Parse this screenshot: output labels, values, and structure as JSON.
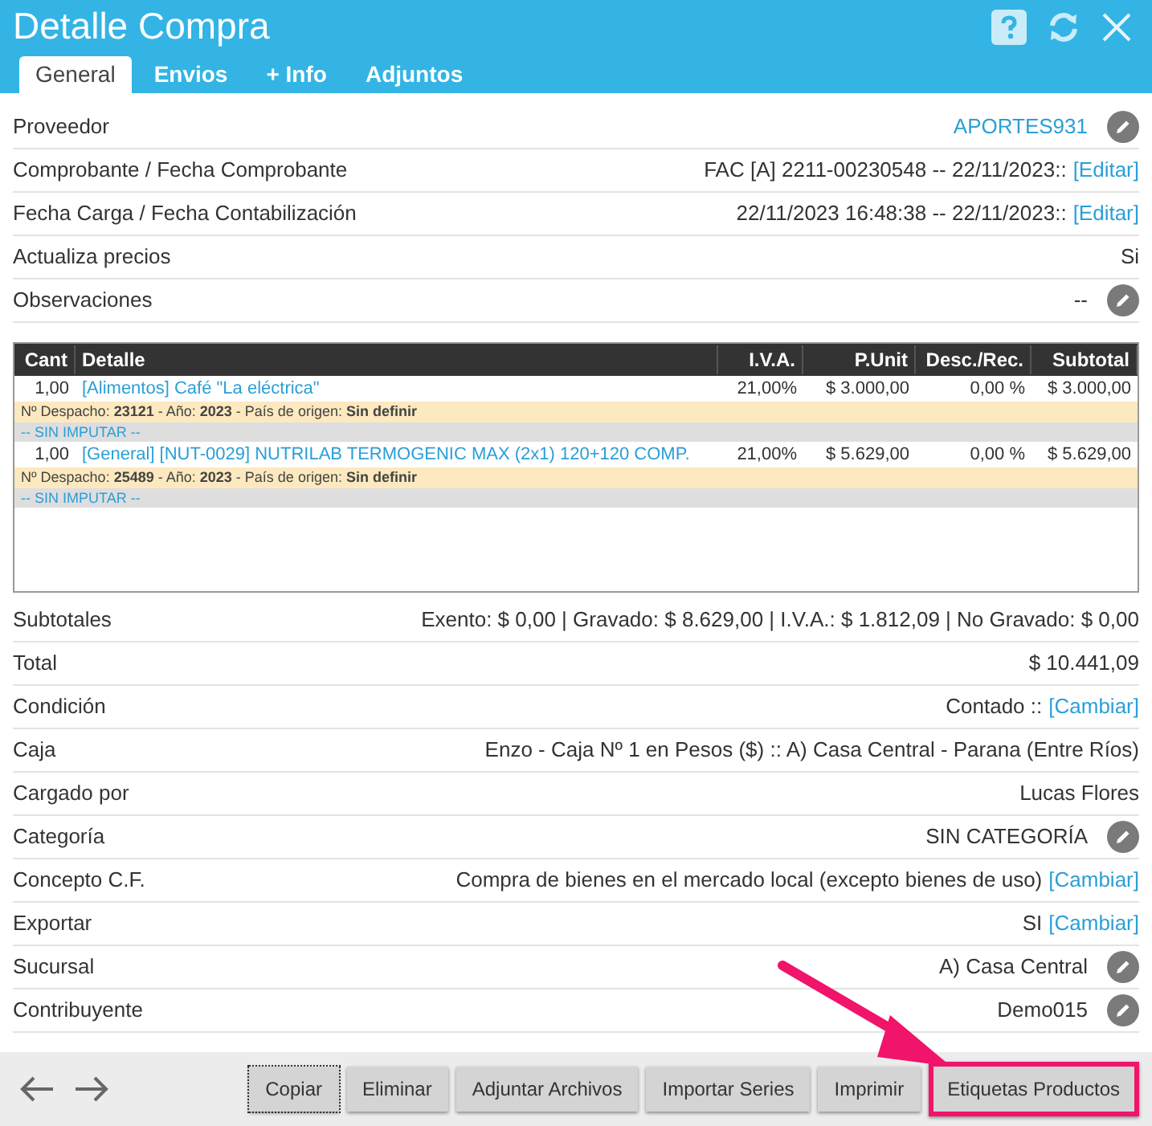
{
  "window": {
    "title": "Detalle Compra"
  },
  "tabs": [
    {
      "label": "General",
      "selected": true
    },
    {
      "label": "Envios",
      "selected": false
    },
    {
      "label": "+ Info",
      "selected": false
    },
    {
      "label": "Adjuntos",
      "selected": false
    }
  ],
  "info_rows": [
    {
      "label": "Proveedor",
      "value": "APORTES931",
      "kind": "link",
      "editable": true
    },
    {
      "label": "Comprobante / Fecha Comprobante",
      "value": "FAC [A] 2211-00230548 -- 22/11/2023::",
      "link": "[Editar]",
      "kind": "plain",
      "editable": false
    },
    {
      "label": "Fecha Carga / Fecha Contabilización",
      "value": "22/11/2023 16:48:38 -- 22/11/2023::",
      "link": "[Editar]",
      "kind": "plain",
      "editable": false
    },
    {
      "label": "Actualiza precios",
      "value": "Si",
      "kind": "plain",
      "editable": false
    },
    {
      "label": "Observaciones",
      "value": "--",
      "kind": "plain",
      "editable": true
    }
  ],
  "table": {
    "columns": [
      "Cant",
      "Detalle",
      "I.V.A.",
      "P.Unit",
      "Desc./Rec.",
      "Subtotal"
    ],
    "rows": [
      {
        "cant": "1,00",
        "detalle": "[Alimentos] Café \"La eléctrica\"",
        "iva": "21,00%",
        "punit": "$ 3.000,00",
        "desc": "0,00 %",
        "subtotal": "$ 3.000,00",
        "despacho": "Nº Despacho: **23121** - Año: **2023** - País de origen: **Sin definir**",
        "imputar": "-- SIN IMPUTAR --"
      },
      {
        "cant": "1,00",
        "detalle": "[General] [NUT-0029] NUTRILAB TERMOGENIC MAX (2x1) 120+120 COMP.",
        "iva": "21,00%",
        "punit": "$ 5.629,00",
        "desc": "0,00 %",
        "subtotal": "$ 5.629,00",
        "despacho": "Nº Despacho: **25489** - Año: **2023** - País de origen: **Sin definir**",
        "imputar": "-- SIN IMPUTAR --"
      }
    ]
  },
  "summary_rows": [
    {
      "label": "Subtotales",
      "value": "Exento: $ 0,00 | Gravado: $ 8.629,00 | I.V.A.: $ 1.812,09 | No Gravado: $ 0,00",
      "kind": "plain",
      "editable": false
    },
    {
      "label": "Total",
      "value": "$ 10.441,09",
      "kind": "plain",
      "editable": false
    },
    {
      "label": "Condición",
      "value": "Contado ::",
      "link": "[Cambiar]",
      "kind": "plain",
      "editable": false
    },
    {
      "label": "Caja",
      "value": "Enzo - Caja Nº 1 en Pesos ($) :: A) Casa Central - Parana (Entre Ríos)",
      "kind": "plain",
      "editable": false
    },
    {
      "label": "Cargado por",
      "value": "Lucas Flores",
      "kind": "plain",
      "editable": false
    },
    {
      "label": "Categoría",
      "value": "SIN CATEGORÍA",
      "kind": "plain",
      "editable": true
    },
    {
      "label": "Concepto C.F.",
      "value": "Compra de bienes en el mercado local (excepto bienes de uso)",
      "link": "[Cambiar]",
      "kind": "plain",
      "editable": false
    },
    {
      "label": "Exportar",
      "value": "SI",
      "link": "[Cambiar]",
      "kind": "plain",
      "editable": false
    },
    {
      "label": "Sucursal",
      "value": "A) Casa Central",
      "kind": "plain",
      "editable": true
    },
    {
      "label": "Contribuyente",
      "value": "Demo015",
      "kind": "plain",
      "editable": true
    }
  ],
  "buttons": [
    {
      "label": "Copiar",
      "focused": true,
      "highlighted": false
    },
    {
      "label": "Eliminar",
      "focused": false,
      "highlighted": false
    },
    {
      "label": "Adjuntar Archivos",
      "focused": false,
      "highlighted": false
    },
    {
      "label": "Importar Series",
      "focused": false,
      "highlighted": false
    },
    {
      "label": "Imprimir",
      "focused": false,
      "highlighted": false
    },
    {
      "label": "Etiquetas Productos",
      "focused": false,
      "highlighted": true
    }
  ]
}
